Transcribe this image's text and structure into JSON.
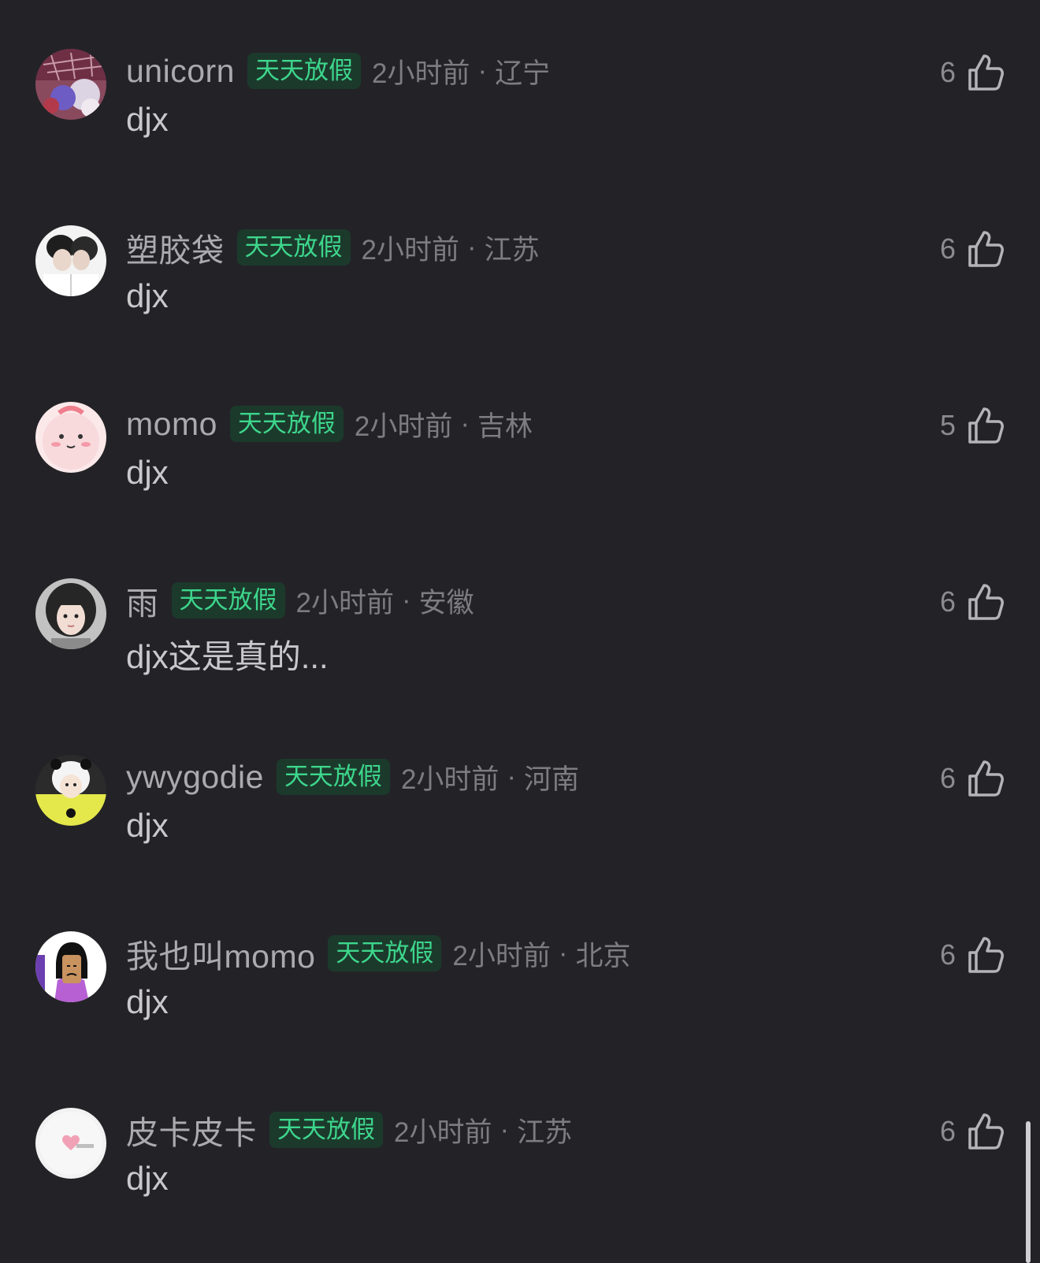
{
  "comments": [
    {
      "username": "unicorn",
      "badge": "天天放假",
      "time": "2小时前",
      "separator": "·",
      "location": "辽宁",
      "text": "djx",
      "likes": "6",
      "avatar_colors": [
        "#7a3b55",
        "#d8c7d8",
        "#6b5fc2"
      ]
    },
    {
      "username": "塑胶袋",
      "badge": "天天放假",
      "time": "2小时前",
      "separator": "·",
      "location": "江苏",
      "text": "djx",
      "likes": "6",
      "avatar_colors": [
        "#f1f1f1",
        "#2a2a2a",
        "#e9d9cf"
      ]
    },
    {
      "username": "momo",
      "badge": "天天放假",
      "time": "2小时前",
      "separator": "·",
      "location": "吉林",
      "text": "djx",
      "likes": "5",
      "avatar_colors": [
        "#f7d9dc",
        "#f28a97",
        "#ffffff"
      ]
    },
    {
      "username": "雨",
      "badge": "天天放假",
      "time": "2小时前",
      "separator": "·",
      "location": "安徽",
      "text": "djx这是真的...",
      "likes": "6",
      "avatar_colors": [
        "#bfbfbf",
        "#2b2b2b",
        "#efd9cf"
      ]
    },
    {
      "username": "ywygodie",
      "badge": "天天放假",
      "time": "2小时前",
      "separator": "·",
      "location": "河南",
      "text": "djx",
      "likes": "6",
      "avatar_colors": [
        "#e5e94a",
        "#111111",
        "#f5e3d6"
      ]
    },
    {
      "username": "我也叫momo",
      "badge": "天天放假",
      "time": "2小时前",
      "separator": "·",
      "location": "北京",
      "text": "djx",
      "likes": "6",
      "avatar_colors": [
        "#ffffff",
        "#b85fd0",
        "#c8935f"
      ]
    },
    {
      "username": "皮卡皮卡",
      "badge": "天天放假",
      "time": "2小时前",
      "separator": "·",
      "location": "江苏",
      "text": "djx",
      "likes": "6",
      "avatar_colors": [
        "#f4f4f4",
        "#f1a1b5",
        "#e6e6e6"
      ]
    }
  ],
  "icons": {
    "like": "thumbs-up-icon"
  },
  "colors": {
    "background": "#232327",
    "badge_text": "#3dd68c",
    "badge_bg": "#1c3a2c"
  }
}
